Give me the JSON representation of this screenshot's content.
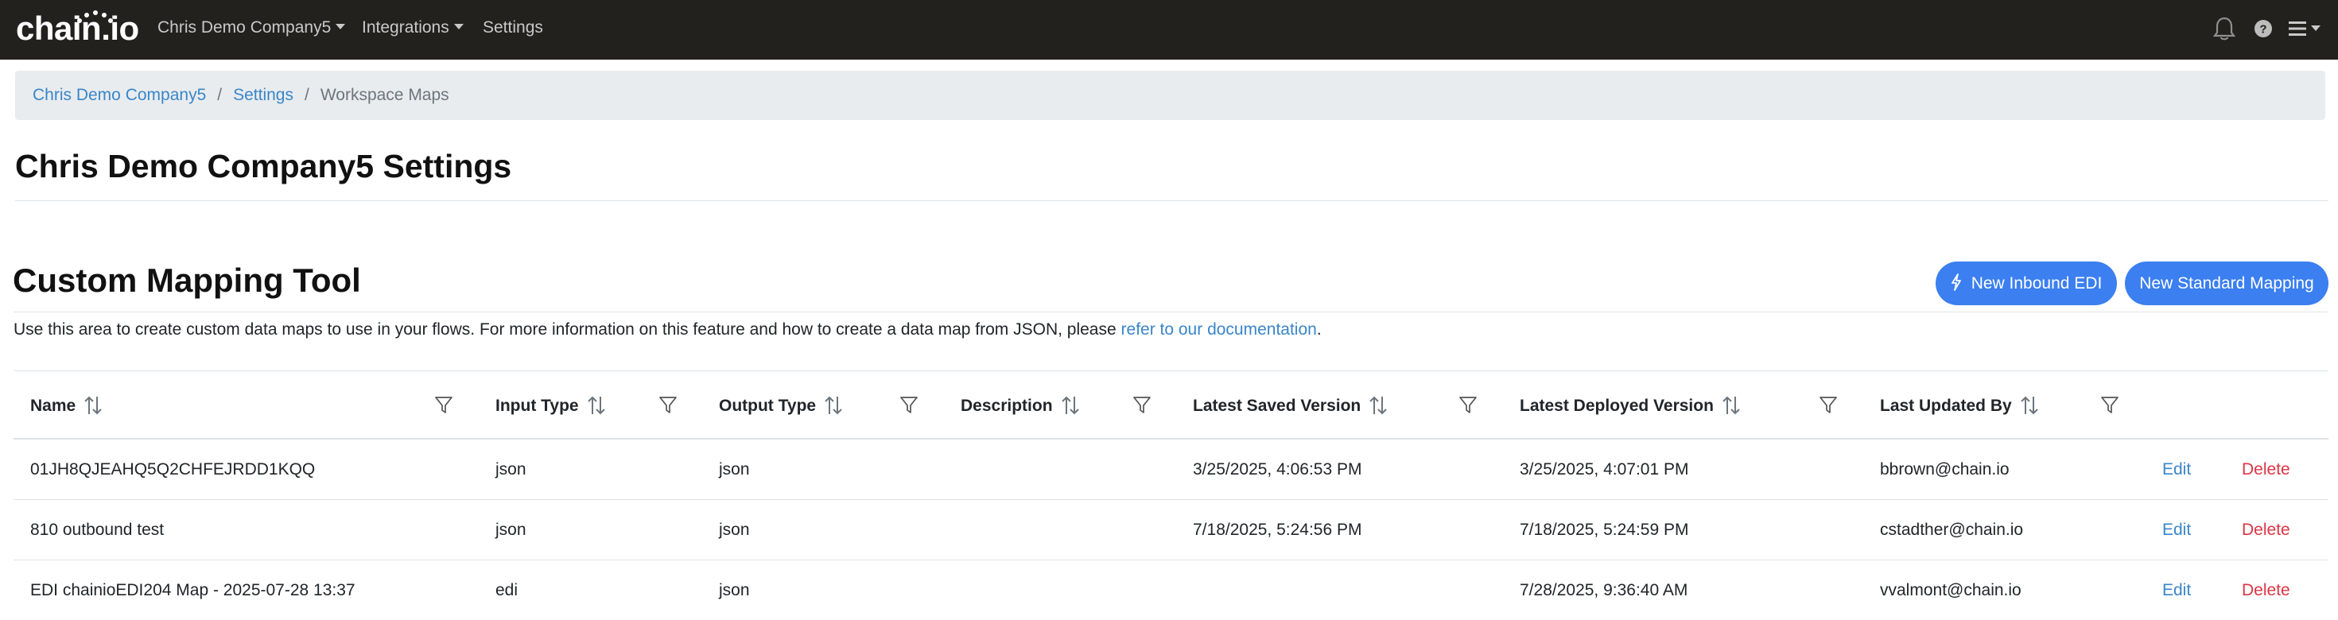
{
  "navbar": {
    "logo": "chain.io",
    "company_menu": "Chris Demo Company5",
    "integrations_menu": "Integrations",
    "settings_link": "Settings",
    "icons": [
      "bell-icon",
      "help-icon",
      "hamburger-menu-icon"
    ]
  },
  "breadcrumb": {
    "items": [
      "Chris Demo Company5",
      "Settings"
    ],
    "separator": "/",
    "active": "Workspace Maps"
  },
  "page_title": "Chris Demo Company5 Settings",
  "section": {
    "title": "Custom Mapping Tool",
    "description_prefix": "Use this area to create custom data maps to use in your flows. For more information on this feature and how to create a data map from JSON, please ",
    "description_link": "refer to our documentation",
    "description_suffix": ".",
    "buttons": {
      "new_inbound_edi": "New Inbound EDI",
      "new_standard_mapping": "New Standard Mapping"
    }
  },
  "table": {
    "columns": [
      "Name",
      "Input Type",
      "Output Type",
      "Description",
      "Latest Saved Version",
      "Latest Deployed Version",
      "Last Updated By"
    ],
    "rows": [
      {
        "name": "01JH8QJEAHQ5Q2CHFEJRDD1KQQ",
        "input_type": "json",
        "output_type": "json",
        "description": "",
        "latest_saved": "3/25/2025, 4:06:53 PM",
        "latest_deployed": "3/25/2025, 4:07:01 PM",
        "updated_by": "bbrown@chain.io",
        "edit": "Edit",
        "delete": "Delete"
      },
      {
        "name": "810 outbound test",
        "input_type": "json",
        "output_type": "json",
        "description": "",
        "latest_saved": "7/18/2025, 5:24:56 PM",
        "latest_deployed": "7/18/2025, 5:24:59 PM",
        "updated_by": "cstadther@chain.io",
        "edit": "Edit",
        "delete": "Delete"
      },
      {
        "name": "EDI chainioEDI204 Map - 2025-07-28 13:37",
        "input_type": "edi",
        "output_type": "json",
        "description": "",
        "latest_saved": "",
        "latest_deployed": "7/28/2025, 9:36:40 AM",
        "updated_by": "vvalmont@chain.io",
        "edit": "Edit",
        "delete": "Delete"
      }
    ]
  },
  "colors": {
    "navbar_bg": "#23211d",
    "link": "#3a86c8",
    "primary_button": "#3b7ff0",
    "danger": "#dc3545",
    "breadcrumb_bg": "#e9ecef"
  }
}
